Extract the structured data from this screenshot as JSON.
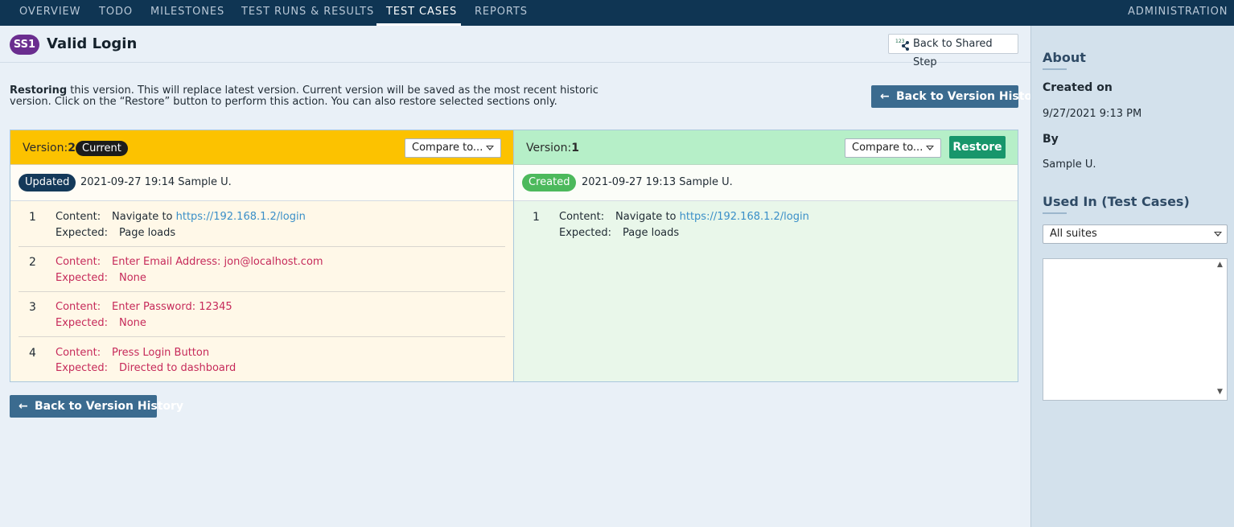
{
  "nav": {
    "tabs": [
      {
        "label": "OVERVIEW"
      },
      {
        "label": "TODO"
      },
      {
        "label": "MILESTONES"
      },
      {
        "label": "TEST RUNS & RESULTS"
      },
      {
        "label": "TEST CASES"
      },
      {
        "label": "REPORTS"
      }
    ],
    "active_tab": "TEST CASES",
    "admin_label": "ADMINISTRATION"
  },
  "header": {
    "badge": "SS1",
    "title": "Valid Login",
    "back_shared_label": "Back to Shared Step",
    "back_shared_icon": "shared-step-icon"
  },
  "notice": {
    "bold": "Restoring",
    "text": " this version. This will replace latest version. Current version will be saved as the most recent historic version. Click on the “Restore” button to perform this action. You can also restore selected sections only."
  },
  "back_to_history_label": "Back to Version History",
  "left_panel": {
    "version_label": "Version:",
    "version_number": "2",
    "current_badge": "Current",
    "compare_placeholder": "Compare to...",
    "status": "Updated",
    "meta": "2021-09-27 19:14 Sample U.",
    "steps": [
      {
        "num": "1",
        "content_label": "Content:",
        "content": "Navigate to ",
        "content_link": "https://192.168.1.2/login",
        "expected_label": "Expected:",
        "expected": "Page loads"
      },
      {
        "num": "2",
        "content_label": "Content:",
        "content": "Enter Email Address: jon@localhost.com",
        "expected_label": "Expected:",
        "expected": "None"
      },
      {
        "num": "3",
        "content_label": "Content:",
        "content": "Enter Password: 12345",
        "expected_label": "Expected:",
        "expected": "None"
      },
      {
        "num": "4",
        "content_label": "Content:",
        "content": "Press Login Button",
        "expected_label": "Expected:",
        "expected": "Directed to dashboard"
      }
    ]
  },
  "right_panel": {
    "version_label": "Version:",
    "version_number": "1",
    "compare_placeholder": "Compare to...",
    "restore_label": "Restore",
    "status": "Created",
    "meta": "2021-09-27 19:13 Sample U.",
    "steps": [
      {
        "num": "1",
        "content_label": "Content:",
        "content": "Navigate to ",
        "content_link": "https://192.168.1.2/login",
        "expected_label": "Expected:",
        "expected": "Page loads"
      }
    ]
  },
  "sidebar": {
    "about_heading": "About",
    "created_on_label": "Created on",
    "created_on_value": "9/27/2021 9:13 PM",
    "by_label": "By",
    "by_value": "Sample U.",
    "used_in_heading": "Used In (Test Cases)",
    "suites_selected": "All suites"
  },
  "colors": {
    "nav_bg": "#0f3553",
    "current_version_bg": "#fcc200",
    "restore_version_bg": "#b6efc8",
    "restore_button": "#17966b",
    "changed_text": "#c62a5a",
    "link": "#3a8fc8"
  }
}
